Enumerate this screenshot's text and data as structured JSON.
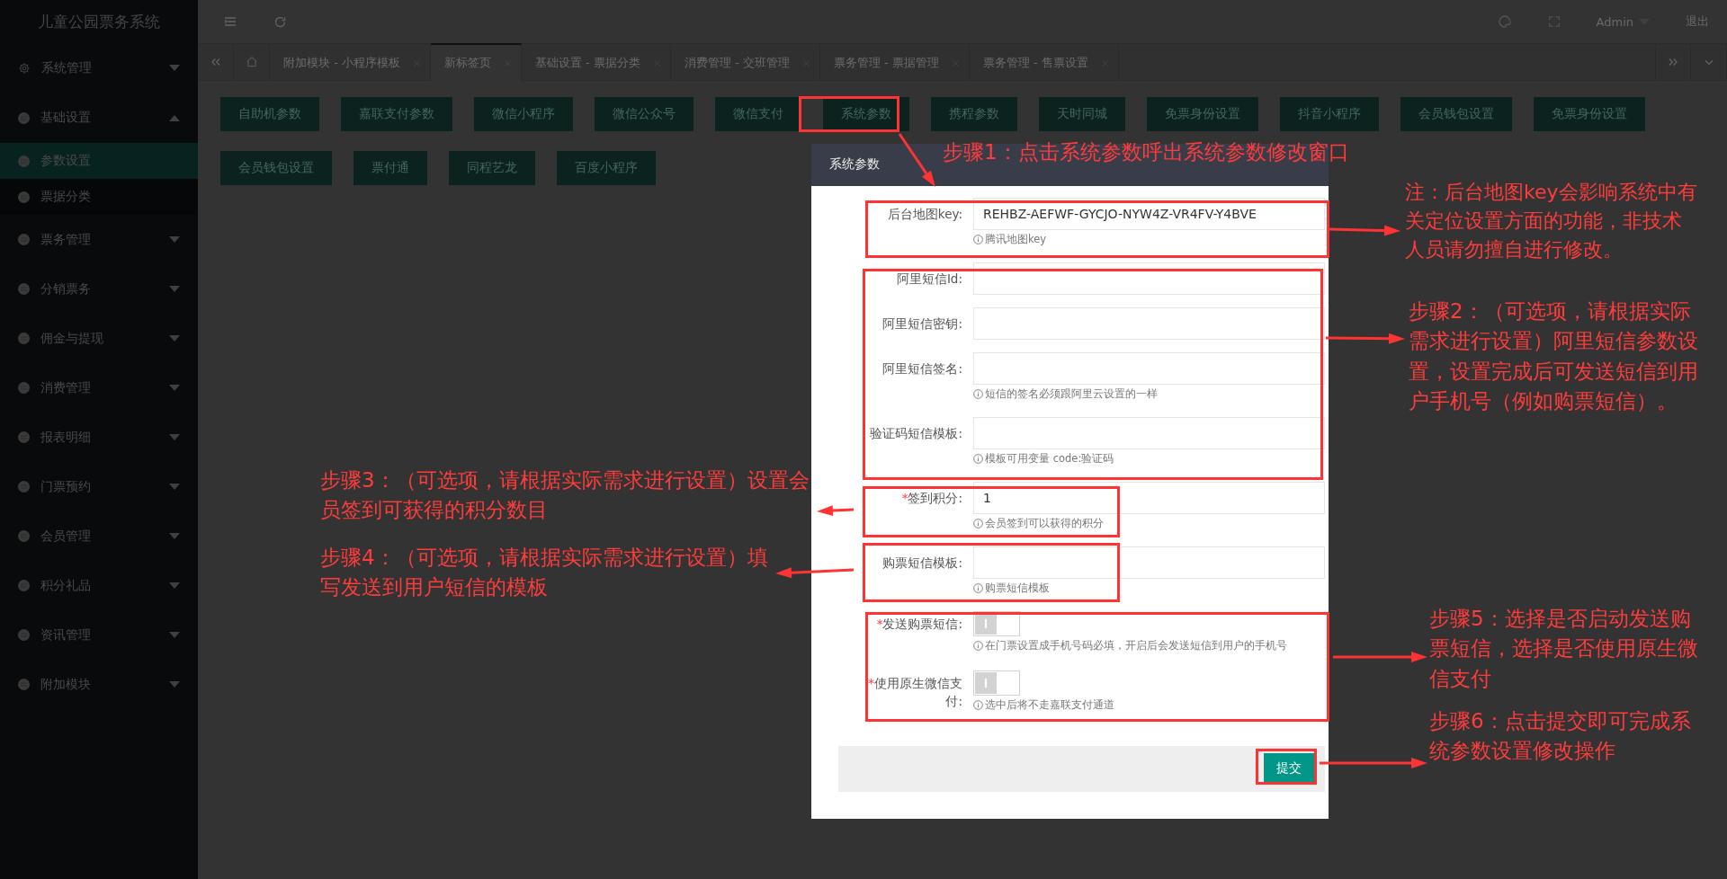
{
  "sidebar": {
    "title": "儿童公园票务系统",
    "items": [
      {
        "label": "系统管理",
        "expanded": false
      },
      {
        "label": "基础设置",
        "expanded": true,
        "children": [
          {
            "label": "参数设置",
            "selected": true
          },
          {
            "label": "票据分类",
            "selected": false
          }
        ]
      },
      {
        "label": "票务管理",
        "expanded": false
      },
      {
        "label": "分销票务",
        "expanded": false
      },
      {
        "label": "佣金与提现",
        "expanded": false
      },
      {
        "label": "消费管理",
        "expanded": false
      },
      {
        "label": "报表明细",
        "expanded": false
      },
      {
        "label": "门票预约",
        "expanded": false
      },
      {
        "label": "会员管理",
        "expanded": false
      },
      {
        "label": "积分礼品",
        "expanded": false
      },
      {
        "label": "资讯管理",
        "expanded": false
      },
      {
        "label": "附加模块",
        "expanded": false
      }
    ]
  },
  "topbar": {
    "user": "Admin",
    "logout": "退出"
  },
  "tabs": [
    {
      "label": "附加模块 - 小程序模板",
      "selected": false
    },
    {
      "label": "新标签页",
      "selected": true
    },
    {
      "label": "基础设置 - 票据分类",
      "selected": false
    },
    {
      "label": "消费管理 - 交班管理",
      "selected": false
    },
    {
      "label": "票务管理 - 票据管理",
      "selected": false
    },
    {
      "label": "票务管理 - 售票设置",
      "selected": false
    }
  ],
  "param_buttons": [
    "自助机参数",
    "嘉联支付参数",
    "微信小程序",
    "微信公众号",
    "微信支付",
    "系统参数",
    "携程参数",
    "天时同城",
    "免票身份设置",
    "抖音小程序",
    "会员钱包设置",
    "免票身份设置",
    "会员钱包设置",
    "票付通",
    "同程艺龙",
    "百度小程序"
  ],
  "dialog": {
    "title": "系统参数",
    "fields": [
      {
        "kind": "text",
        "label": "后台地图key:",
        "value": "REHBZ-AEFWF-GYCJO-NYW4Z-VR4FV-Y4BVE",
        "hint": "腾讯地图key"
      },
      {
        "kind": "text",
        "label": "阿里短信Id:"
      },
      {
        "kind": "text",
        "label": "阿里短信密钥:"
      },
      {
        "kind": "text",
        "label": "阿里短信签名:",
        "hint": "短信的签名必须跟阿里云设置的一样"
      },
      {
        "kind": "text",
        "label": "验证码短信模板:",
        "hint": "模板可用变量 code:验证码"
      },
      {
        "kind": "text",
        "required_mark": "*",
        "label": "签到积分:",
        "value": "1",
        "hint": "会员签到可以获得的积分"
      },
      {
        "kind": "text",
        "label": "购票短信模板:",
        "hint": "购票短信模板"
      },
      {
        "kind": "switch",
        "required_mark": "*",
        "label": "发送购票短信:",
        "on": false,
        "hint": "在门票设置成手机号码必填，开启后会发送短信到用户的手机号"
      },
      {
        "kind": "switch",
        "required_mark": "*",
        "label": "使用原生微信支付:",
        "on": false,
        "hint": "选中后将不走嘉联支付通道"
      }
    ],
    "submit": "提交"
  },
  "annotations": [
    "步骤1：点击系统参数呼出系统参数修改窗口",
    "注：后台地图key会影响系统中有关定位设置方面的功能，非技术人员请勿擅自进行修改。",
    "步骤2：（可选项，请根据实际需求进行设置）阿里短信参数设置，设置完成后可发送短信到用户手机号（例如购票短信）。",
    "步骤3：（可选项，请根据实际需求进行设置）设置会员签到可获得的积分数目",
    "步骤4：（可选项，请根据实际需求进行设置）填写发送到用户短信的模板",
    "步骤5：选择是否启动发送购票短信，选择是否使用原生微信支付",
    "步骤6：点击提交即可完成系统参数设置修改操作"
  ]
}
